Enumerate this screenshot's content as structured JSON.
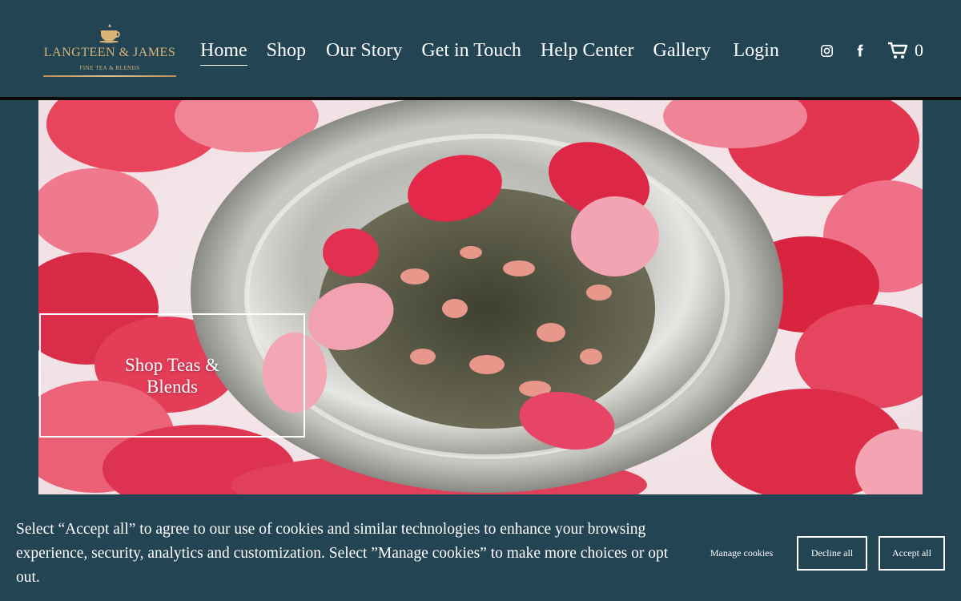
{
  "brand": {
    "name": "LANGTEEN & JAMES",
    "tagline": "FINE TEA & BLENDS",
    "gold": "#c9a66b"
  },
  "nav": {
    "items": [
      {
        "label": "Home",
        "active": true
      },
      {
        "label": "Shop"
      },
      {
        "label": "Our Story"
      },
      {
        "label": "Get in Touch"
      },
      {
        "label": "Help Center"
      },
      {
        "label": "Gallery"
      },
      {
        "label": "Login"
      }
    ]
  },
  "social": {
    "icons": [
      "instagram-icon",
      "facebook-icon"
    ]
  },
  "cart": {
    "icon": "cart-icon",
    "count": "0"
  },
  "hero": {
    "button_label": "Shop Teas & Blends",
    "image": "rose-petal-tea-on-silver-plate"
  },
  "cookie": {
    "text": "Select “Accept all” to agree to our use of cookies and similar technologies to enhance your browsing experience, security, analytics and customization. Select ”Manage cookies” to make more choices or opt out.",
    "manage_label": "Manage cookies",
    "decline_label": "Decline all",
    "accept_label": "Accept all"
  },
  "colors": {
    "background": "#234553",
    "header_rule": "#0a0a0a",
    "text": "#ffffff"
  }
}
